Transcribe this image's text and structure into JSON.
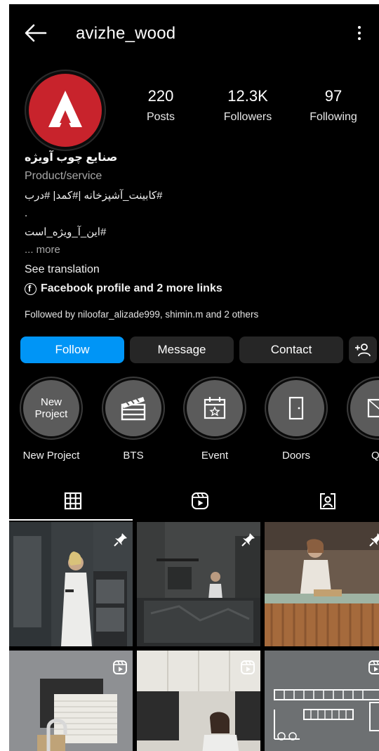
{
  "header": {
    "username": "avizhe_wood"
  },
  "stats": [
    {
      "value": "220",
      "label": "Posts"
    },
    {
      "value": "12.3K",
      "label": "Followers"
    },
    {
      "value": "97",
      "label": "Following"
    }
  ],
  "bio": {
    "name": "صنایع چوب آویژه",
    "category": "Product/service",
    "line1": "کابینت_آشپزخانه |#کمد| #درب#",
    "line2": ".",
    "line3": "این_آ_ویژه_است#",
    "more": "... more",
    "see_translation": "See translation",
    "links": "Facebook profile and 2 more links",
    "followed_by": "Followed by niloofar_alizade999, shimin.m and 2 others"
  },
  "actions": {
    "follow": "Follow",
    "message": "Message",
    "contact": "Contact"
  },
  "highlights": [
    {
      "label": "New Project",
      "cover_text": "New\nProject",
      "icon": "text-cover"
    },
    {
      "label": "BTS",
      "icon": "clapperboard-icon"
    },
    {
      "label": "Event",
      "icon": "calendar-star-icon"
    },
    {
      "label": "Doors",
      "icon": "door-icon"
    },
    {
      "label": "Qu",
      "icon": "image-icon"
    }
  ],
  "tabs": [
    {
      "name": "posts-grid",
      "icon": "grid-icon",
      "active": true
    },
    {
      "name": "reels",
      "icon": "reels-icon",
      "active": false
    },
    {
      "name": "tagged",
      "icon": "tagged-icon",
      "active": false
    }
  ],
  "grid": [
    {
      "kind": "pinned-post"
    },
    {
      "kind": "pinned-post"
    },
    {
      "kind": "pinned-post"
    },
    {
      "kind": "reel"
    },
    {
      "kind": "reel"
    },
    {
      "kind": "reel"
    }
  ],
  "colors": {
    "background": "#000000",
    "accent_blue": "#0095f6",
    "button_gray": "#262626",
    "brand_red": "#c8232c",
    "secondary_text": "#a8a8a8"
  }
}
